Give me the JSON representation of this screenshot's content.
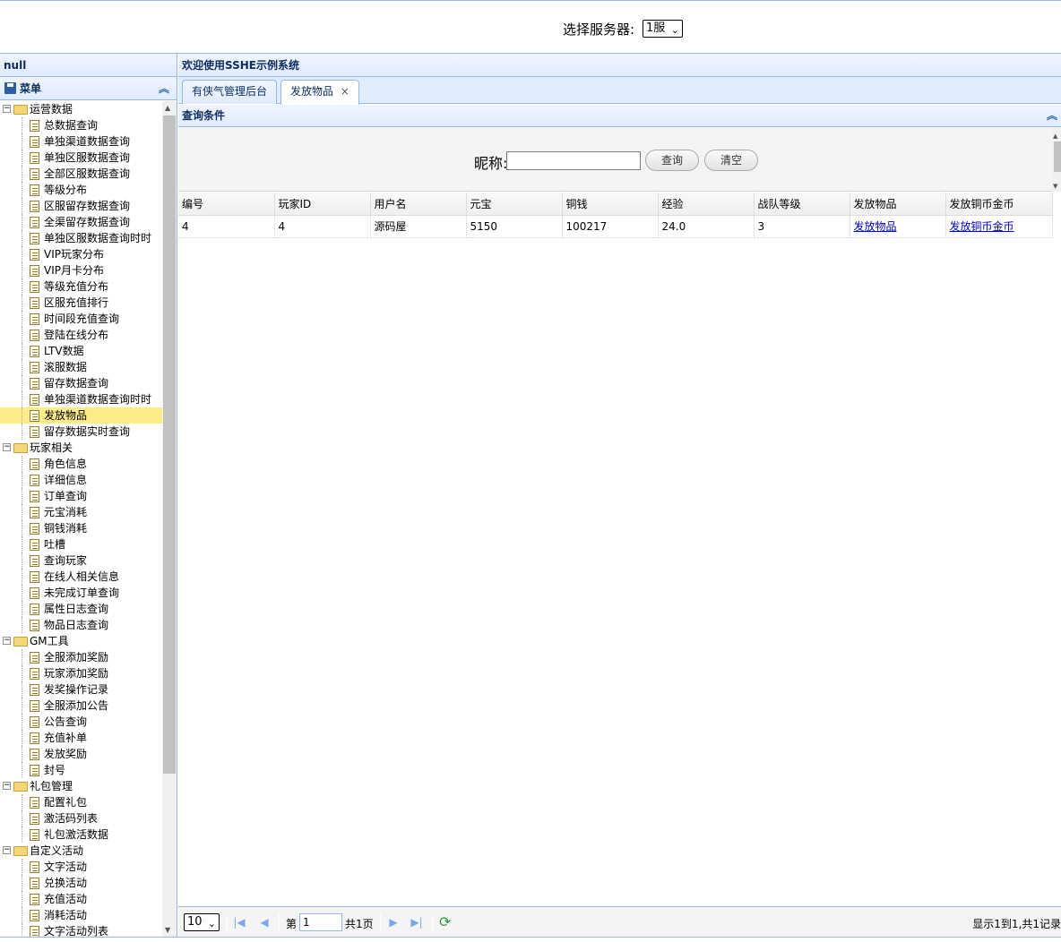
{
  "header": {
    "server_label": "选择服务器:",
    "server_selected": "1服"
  },
  "west": {
    "title": "null",
    "menu_title": "菜单"
  },
  "tree": [
    {
      "type": "folder",
      "label": "运营数据"
    },
    {
      "type": "leaf",
      "label": "总数据查询"
    },
    {
      "type": "leaf",
      "label": "单独渠道数据查询"
    },
    {
      "type": "leaf",
      "label": "单独区服数据查询"
    },
    {
      "type": "leaf",
      "label": "全部区服数据查询"
    },
    {
      "type": "leaf",
      "label": "等级分布"
    },
    {
      "type": "leaf",
      "label": "区服留存数据查询"
    },
    {
      "type": "leaf",
      "label": "全渠留存数据查询"
    },
    {
      "type": "leaf",
      "label": "单独区服数据查询时时"
    },
    {
      "type": "leaf",
      "label": "VIP玩家分布"
    },
    {
      "type": "leaf",
      "label": "VIP月卡分布"
    },
    {
      "type": "leaf",
      "label": "等级充值分布"
    },
    {
      "type": "leaf",
      "label": "区服充值排行"
    },
    {
      "type": "leaf",
      "label": "时间段充值查询"
    },
    {
      "type": "leaf",
      "label": "登陆在线分布"
    },
    {
      "type": "leaf",
      "label": "LTV数据"
    },
    {
      "type": "leaf",
      "label": "滚服数据"
    },
    {
      "type": "leaf",
      "label": "留存数据查询"
    },
    {
      "type": "leaf",
      "label": "单独渠道数据查询时时"
    },
    {
      "type": "leaf",
      "label": "发放物品",
      "selected": true
    },
    {
      "type": "leaf",
      "label": "留存数据实时查询"
    },
    {
      "type": "folder",
      "label": "玩家相关"
    },
    {
      "type": "leaf",
      "label": "角色信息"
    },
    {
      "type": "leaf",
      "label": "详细信息"
    },
    {
      "type": "leaf",
      "label": "订单查询"
    },
    {
      "type": "leaf",
      "label": "元宝消耗"
    },
    {
      "type": "leaf",
      "label": "铜钱消耗"
    },
    {
      "type": "leaf",
      "label": "吐槽"
    },
    {
      "type": "leaf",
      "label": "查询玩家"
    },
    {
      "type": "leaf",
      "label": "在线人相关信息"
    },
    {
      "type": "leaf",
      "label": "未完成订单查询"
    },
    {
      "type": "leaf",
      "label": "属性日志查询"
    },
    {
      "type": "leaf",
      "label": "物品日志查询"
    },
    {
      "type": "folder",
      "label": "GM工具"
    },
    {
      "type": "leaf",
      "label": "全服添加奖励"
    },
    {
      "type": "leaf",
      "label": "玩家添加奖励"
    },
    {
      "type": "leaf",
      "label": "发奖操作记录"
    },
    {
      "type": "leaf",
      "label": "全服添加公告"
    },
    {
      "type": "leaf",
      "label": "公告查询"
    },
    {
      "type": "leaf",
      "label": "充值补单"
    },
    {
      "type": "leaf",
      "label": "发放奖励"
    },
    {
      "type": "leaf",
      "label": "封号"
    },
    {
      "type": "folder",
      "label": "礼包管理"
    },
    {
      "type": "leaf",
      "label": "配置礼包"
    },
    {
      "type": "leaf",
      "label": "激活码列表"
    },
    {
      "type": "leaf",
      "label": "礼包激活数据"
    },
    {
      "type": "folder",
      "label": "自定义活动"
    },
    {
      "type": "leaf",
      "label": "文字活动"
    },
    {
      "type": "leaf",
      "label": "兑换活动"
    },
    {
      "type": "leaf",
      "label": "充值活动"
    },
    {
      "type": "leaf",
      "label": "消耗活动"
    },
    {
      "type": "leaf",
      "label": "文字活动列表"
    }
  ],
  "center": {
    "title": "欢迎使用SSHE示例系统",
    "tabs": [
      {
        "label": "有侠气管理后台",
        "active": false
      },
      {
        "label": "发放物品",
        "active": true,
        "close": "×"
      }
    ]
  },
  "query": {
    "header": "查询条件",
    "nickname_label": "昵称:",
    "nickname_value": "",
    "query_button": "查询",
    "clear_button": "清空"
  },
  "grid": {
    "columns": [
      "编号",
      "玩家ID",
      "用户名",
      "元宝",
      "铜钱",
      "经验",
      "战队等级",
      "发放物品",
      "发放铜币金币"
    ],
    "rows": [
      [
        "4",
        "4",
        "源码屋",
        "5150",
        "100217",
        "24.0",
        "3",
        "发放物品",
        "发放铜币金币"
      ]
    ]
  },
  "pager": {
    "page_size": "10",
    "page_label": "第",
    "page_value": "1",
    "total_pages": "共1页",
    "summary": "显示1到1,共1记录"
  }
}
